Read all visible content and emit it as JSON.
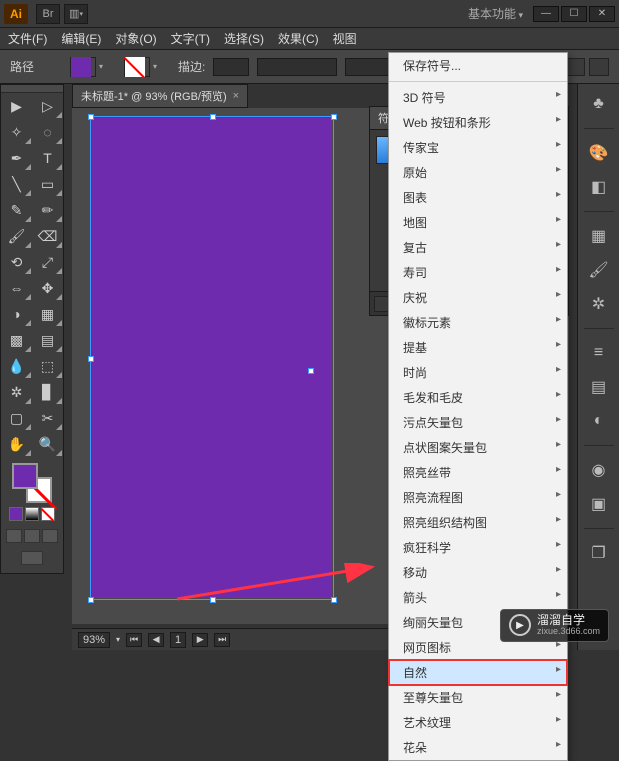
{
  "titlebar": {
    "logo": "Ai",
    "br": "Br",
    "workspace": "基本功能"
  },
  "win": {
    "min": "—",
    "max": "☐",
    "close": "✕"
  },
  "menu": {
    "file": "文件(F)",
    "edit": "编辑(E)",
    "object": "对象(O)",
    "type": "文字(T)",
    "select": "选择(S)",
    "effect": "效果(C)",
    "view": "视图"
  },
  "control": {
    "path_label": "路径",
    "stroke_label": "描边:"
  },
  "doc": {
    "tab": "未标题-1* @ 93% (RGB/预览)",
    "close": "×"
  },
  "symbols": {
    "tab": "符号"
  },
  "status": {
    "zoom": "93%",
    "page": "1"
  },
  "dropdown": {
    "save": "保存符号...",
    "items": [
      "3D 符号",
      "Web 按钮和条形",
      "传家宝",
      "原始",
      "图表",
      "地图",
      "复古",
      "寿司",
      "庆祝",
      "徽标元素",
      "提基",
      "时尚",
      "毛发和毛皮",
      "污点矢量包",
      "点状图案矢量包",
      "照亮丝带",
      "照亮流程图",
      "照亮组织结构图",
      "疯狂科学",
      "移动",
      "箭头",
      "绚丽矢量包",
      "网页图标",
      "自然",
      "至尊矢量包",
      "艺术纹理",
      "花朵"
    ],
    "highlight_index": 23
  },
  "watermark": {
    "title": "溜溜自学",
    "url": "zixue.3d66.com"
  }
}
